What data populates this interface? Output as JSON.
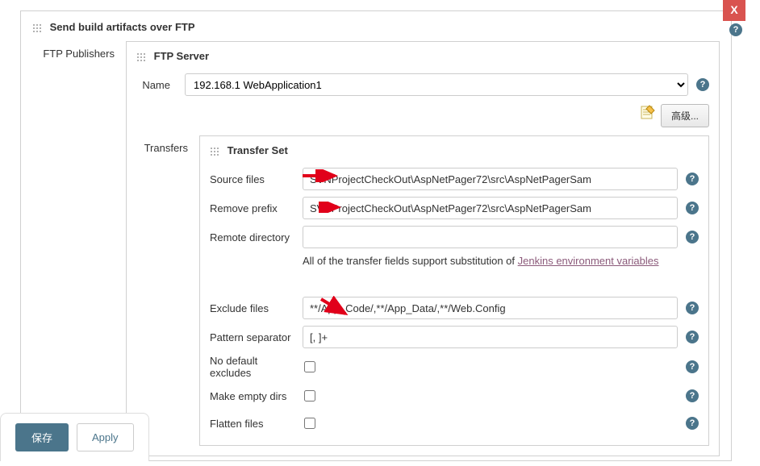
{
  "closeBtn": "X",
  "sectionTitle": "Send build artifacts over FTP",
  "leftLabels": {
    "ftpPublishers": "FTP Publishers",
    "transfers": "Transfers"
  },
  "ftpServer": {
    "header": "FTP Server",
    "nameLabel": "Name",
    "nameValue": "192.168.1         WebApplication1",
    "advancedBtn": "高级..."
  },
  "transferSet": {
    "header": "Transfer Set",
    "sourceFilesLabel": "Source files",
    "sourceFilesValue": "SVNProjectCheckOut\\AspNetPager72\\src\\AspNetPagerSam",
    "removePrefixLabel": "Remove prefix",
    "removePrefixValue": "SVNProjectCheckOut\\AspNetPager72\\src\\AspNetPagerSam",
    "remoteDirLabel": "Remote directory",
    "remoteDirValue": "",
    "helpText1": "All of the transfer fields support substitution of ",
    "helpLink": "Jenkins environment variables",
    "excludeFilesLabel": "Exclude files",
    "excludeFilesValue": "**/App_Code/,**/App_Data/,**/Web.Config",
    "patternSepLabel": "Pattern separator",
    "patternSepValue": "[, ]+",
    "noDefaultExcludesLabel": "No default excludes",
    "makeEmptyDirsLabel": "Make empty dirs",
    "flattenFilesLabel": "Flatten files"
  },
  "bottomBar": {
    "save": "保存",
    "apply": "Apply"
  }
}
